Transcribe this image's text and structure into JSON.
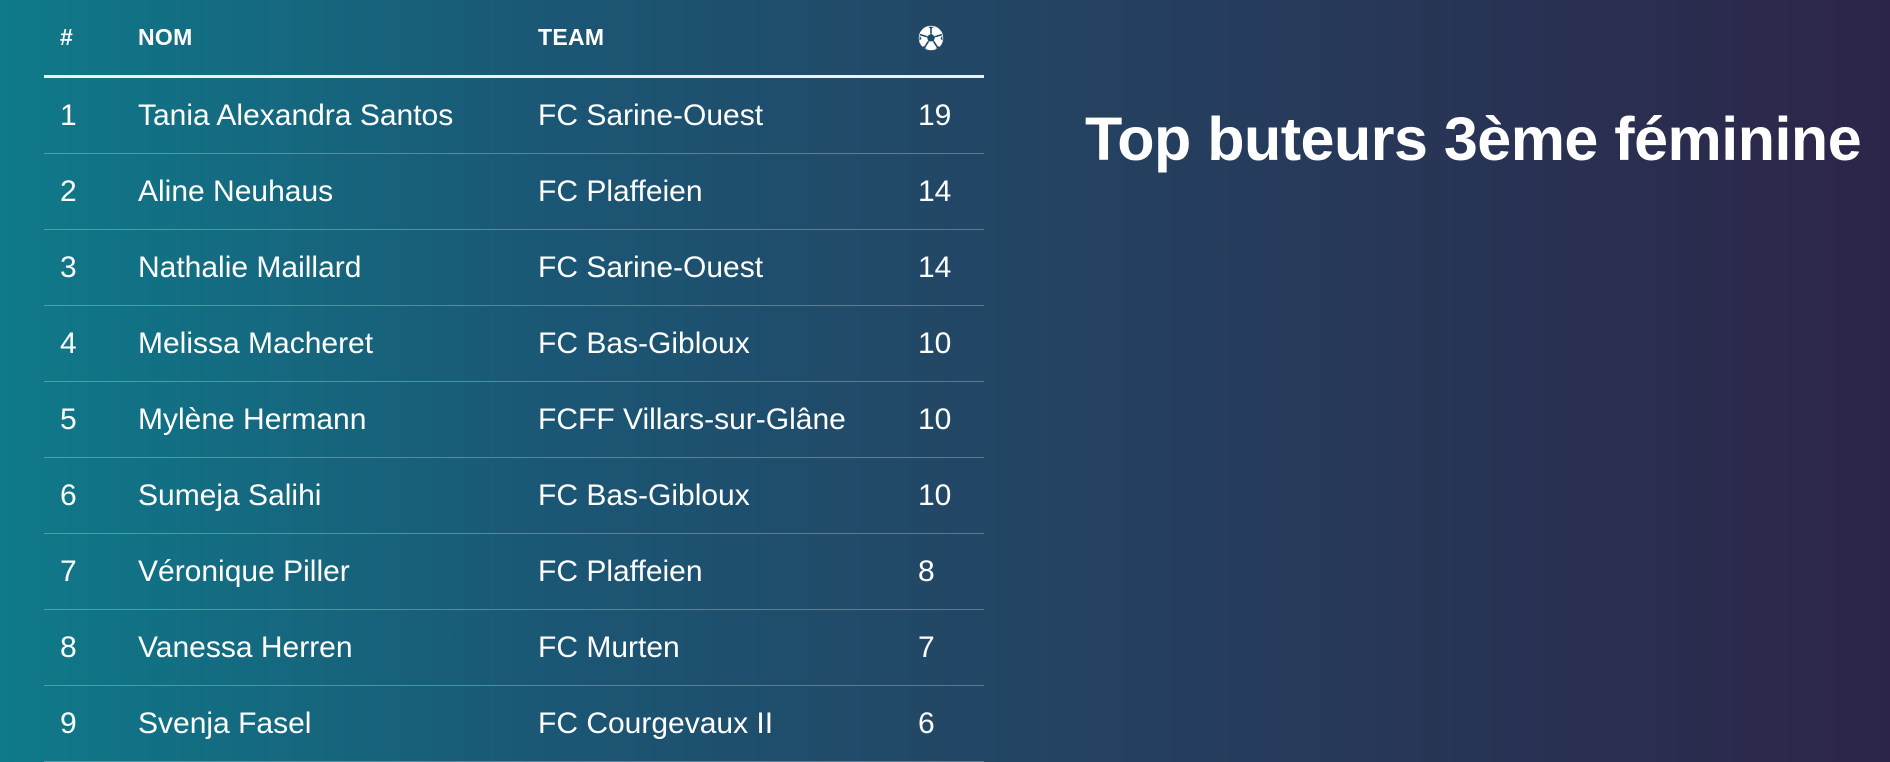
{
  "title": "Top buteurs 3ème féminine",
  "table": {
    "headers": {
      "rank": "#",
      "name": "NOM",
      "team": "TEAM",
      "goals_icon": "soccer-ball-icon"
    },
    "rows": [
      {
        "rank": "1",
        "name": "Tania Alexandra Santos",
        "team": "FC Sarine-Ouest",
        "goals": "19"
      },
      {
        "rank": "2",
        "name": "Aline Neuhaus",
        "team": "FC Plaffeien",
        "goals": "14"
      },
      {
        "rank": "3",
        "name": "Nathalie Maillard",
        "team": "FC Sarine-Ouest",
        "goals": "14"
      },
      {
        "rank": "4",
        "name": "Melissa Macheret",
        "team": "FC Bas-Gibloux",
        "goals": "10"
      },
      {
        "rank": "5",
        "name": "Mylène Hermann",
        "team": "FCFF Villars-sur-Glâne",
        "goals": "10"
      },
      {
        "rank": "6",
        "name": "Sumeja Salihi",
        "team": "FC Bas-Gibloux",
        "goals": "10"
      },
      {
        "rank": "7",
        "name": "Véronique Piller",
        "team": "FC Plaffeien",
        "goals": "8"
      },
      {
        "rank": "8",
        "name": "Vanessa Herren",
        "team": "FC Murten",
        "goals": "7"
      },
      {
        "rank": "9",
        "name": "Svenja Fasel",
        "team": "FC Courgevaux II",
        "goals": "6"
      }
    ]
  },
  "colors": {
    "background_start": "#0f7a8a",
    "background_end": "#2c2549",
    "text": "#ffffff"
  }
}
